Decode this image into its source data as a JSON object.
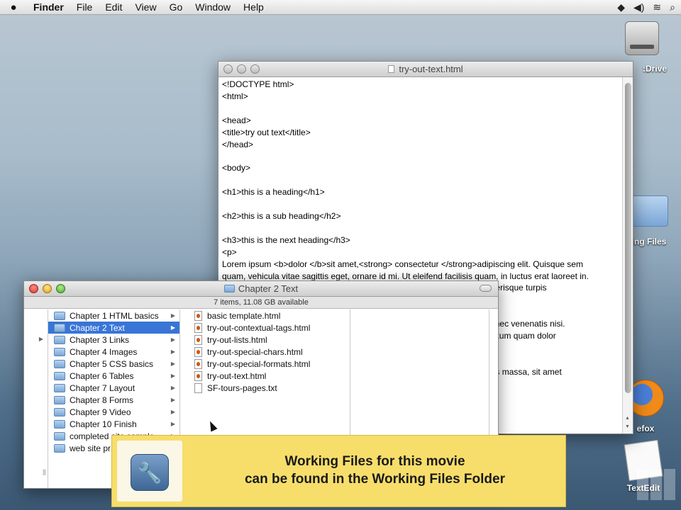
{
  "menubar": {
    "apple": "",
    "app": "Finder",
    "items": [
      "File",
      "Edit",
      "View",
      "Go",
      "Window",
      "Help"
    ],
    "status_icons": [
      "dropbox-icon",
      "volume-icon",
      "wifi-icon",
      "spotlight-icon"
    ]
  },
  "desktop": {
    "icons": [
      {
        "label": ":Drive",
        "icon": "hard-drive-icon"
      },
      {
        "label": "ing Files",
        "icon": "folder-icon"
      },
      {
        "label": "efox",
        "icon": "firefox-icon"
      },
      {
        "label": "TextEdit",
        "icon": "textedit-icon"
      }
    ]
  },
  "textedit": {
    "title": "try-out-text.html",
    "content": "<!DOCTYPE html>\n<html>\n\n<head>\n<title>try out text</title>\n</head>\n\n<body>\n\n<h1>this is a heading</h1>\n\n<h2>this is a sub heading</h2>\n\n<h3>this is the next heading</h3>\n<p>\nLorem ipsum <b>dolor </b>sit amet,<strong> consectetur </strong>adipiscing elit. Quisque sem\nquam, vehicula vitae sagittis eget, ornare id mi. Ut eleifend facilisis quam, in luctus erat laoreet in.\n                                                                                                 terdum scelerisque turpis\n\n\n                                                                                                rna. Nullam nec venenatis nisi.\n                                                                                                , non fermentum quam dolor\n\n\n                                                                                                lus eu mauris massa, sit amet"
  },
  "finder": {
    "title": "Chapter 2 Text",
    "status": "7 items, 11.08 GB available",
    "folders": [
      {
        "label": "Chapter 1 HTML basics",
        "selected": false
      },
      {
        "label": "Chapter 2 Text",
        "selected": true
      },
      {
        "label": "Chapter 3 Links",
        "selected": false
      },
      {
        "label": "Chapter 4 Images",
        "selected": false
      },
      {
        "label": "Chapter 5 CSS basics",
        "selected": false
      },
      {
        "label": "Chapter 6 Tables",
        "selected": false
      },
      {
        "label": "Chapter 7 Layout",
        "selected": false
      },
      {
        "label": "Chapter 8 Forms",
        "selected": false
      },
      {
        "label": "Chapter 9 Video",
        "selected": false
      },
      {
        "label": "Chapter 10 Finish",
        "selected": false
      },
      {
        "label": "completed site sample",
        "selected": false
      },
      {
        "label": "web site pr",
        "selected": false
      }
    ],
    "files": [
      {
        "label": "basic template.html",
        "type": "html"
      },
      {
        "label": "try-out-contextual-tags.html",
        "type": "html"
      },
      {
        "label": "try-out-lists.html",
        "type": "html"
      },
      {
        "label": "try-out-special-chars.html",
        "type": "html"
      },
      {
        "label": "try-out-special-formats.html",
        "type": "html"
      },
      {
        "label": "try-out-text.html",
        "type": "html"
      },
      {
        "label": "SF-tours-pages.txt",
        "type": "txt"
      }
    ]
  },
  "banner": {
    "line1": "Working Files for this movie",
    "line2": "can be found in the Working Files Folder",
    "icon": "wrench-icon"
  }
}
